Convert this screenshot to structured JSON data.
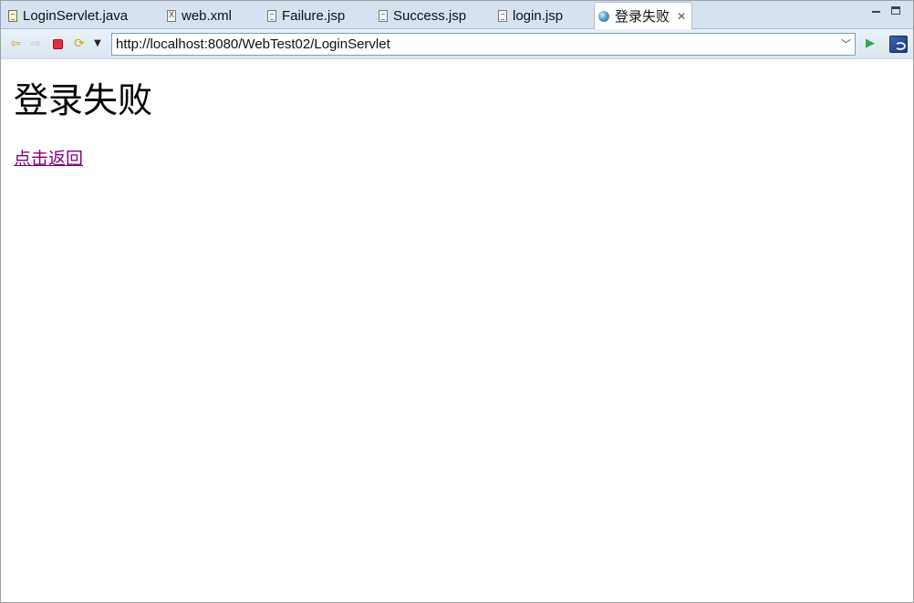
{
  "tabs": [
    {
      "label": "LoginServlet.java",
      "icon": "java-file-icon"
    },
    {
      "label": "web.xml",
      "icon": "xml-file-icon"
    },
    {
      "label": "Failure.jsp",
      "icon": "jsp-file-icon"
    },
    {
      "label": "Success.jsp",
      "icon": "jsp-file-icon"
    },
    {
      "label": "login.jsp",
      "icon": "jsp-file-icon"
    },
    {
      "label": "登录失败",
      "icon": "globe-icon",
      "active": true
    }
  ],
  "toolbar": {
    "url": "http://localhost:8080/WebTest02/LoginServlet"
  },
  "page": {
    "heading": "登录失败",
    "link_text": "点击返回"
  },
  "colors": {
    "tabbar_bg": "#d6e2ef",
    "visited_link": "#800080"
  }
}
